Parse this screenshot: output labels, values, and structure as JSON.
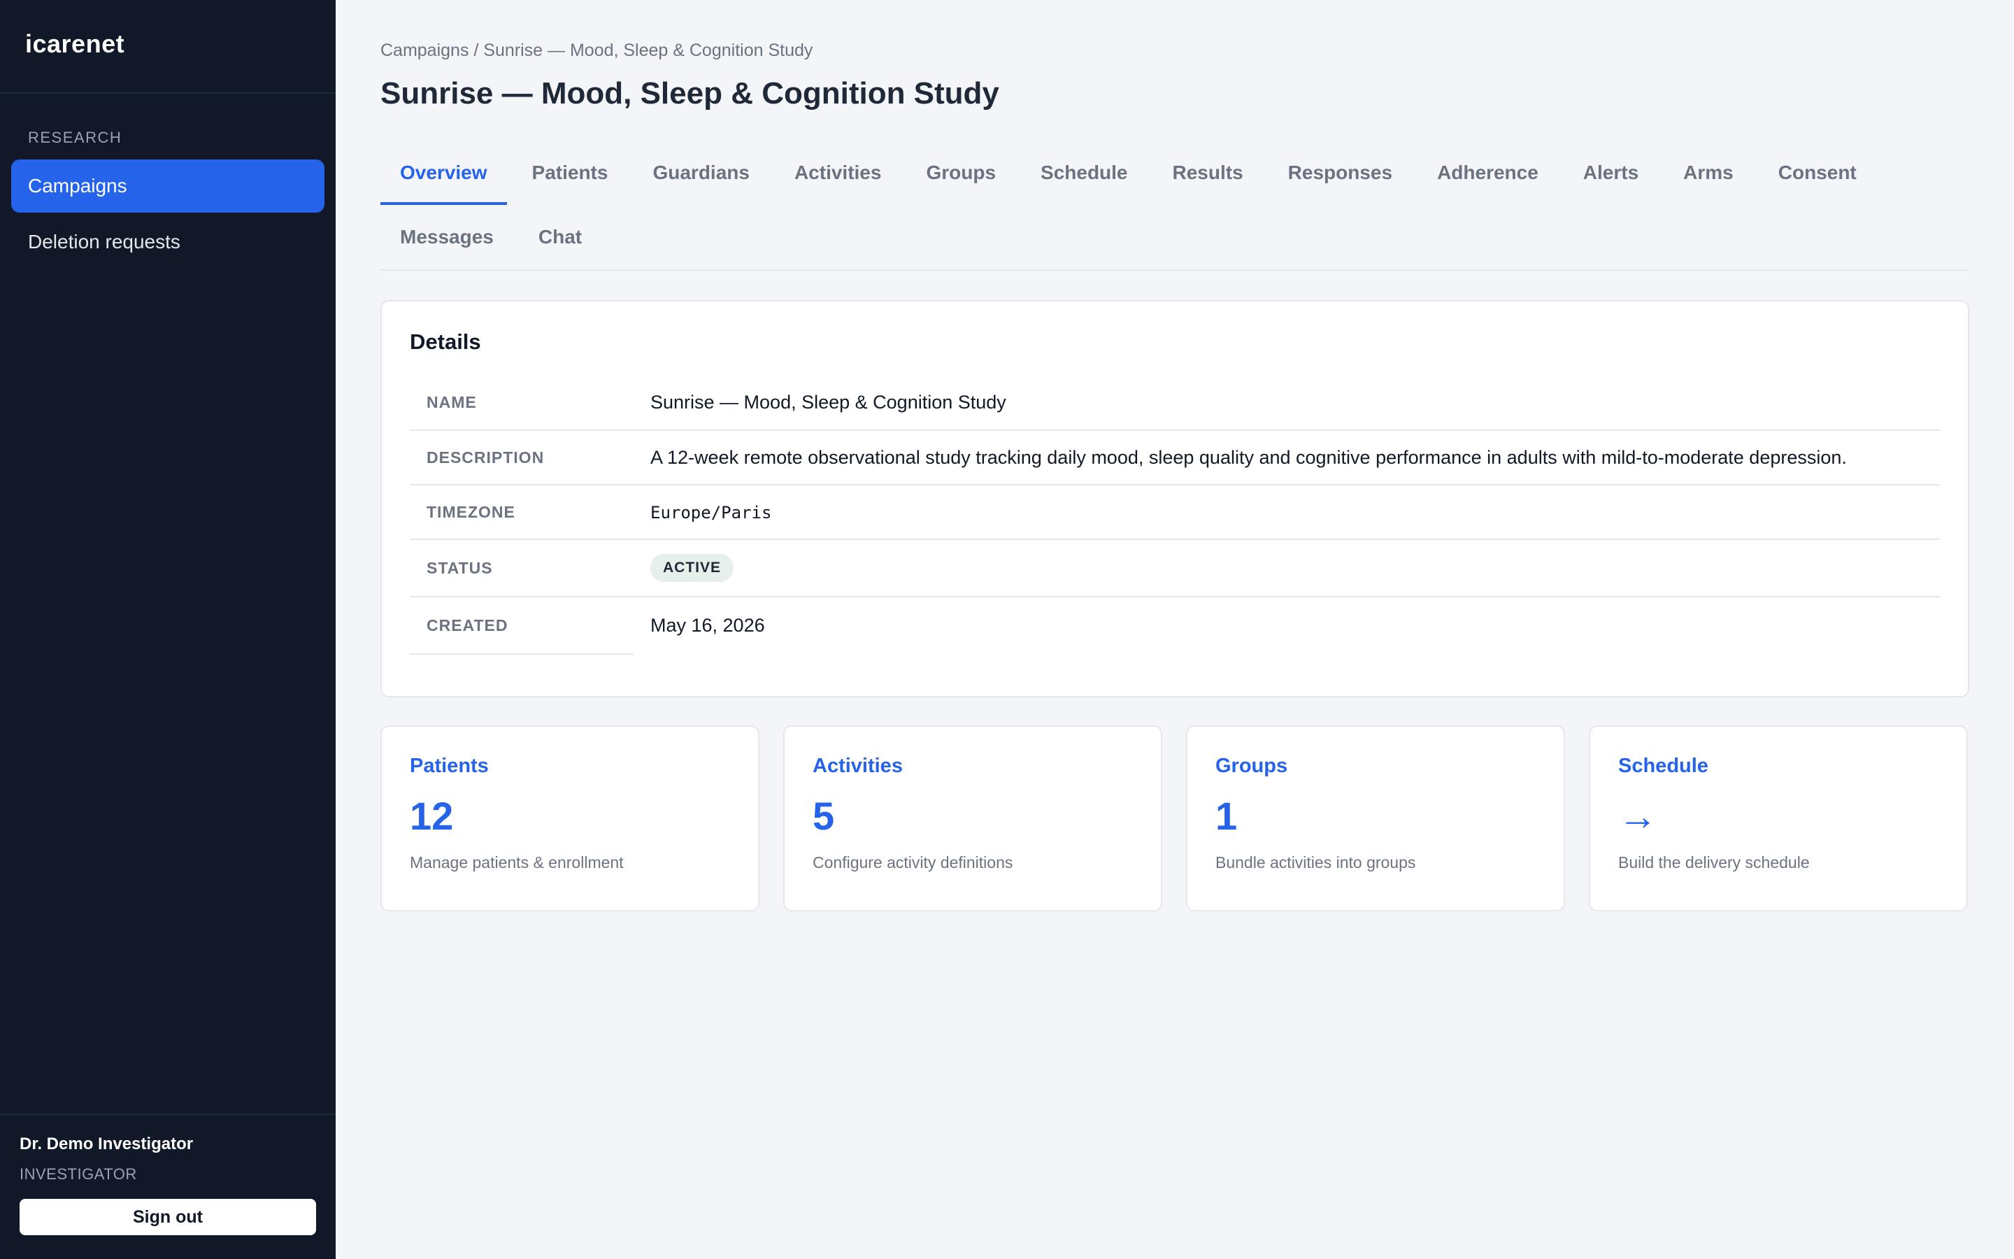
{
  "sidebar": {
    "brand": "icarenet",
    "section_label": "RESEARCH",
    "items": [
      {
        "label": "Campaigns",
        "active": true
      },
      {
        "label": "Deletion requests",
        "active": false
      }
    ],
    "user": {
      "name": "Dr. Demo Investigator",
      "role": "INVESTIGATOR",
      "signout_label": "Sign out"
    }
  },
  "header": {
    "breadcrumb": "Campaigns / Sunrise — Mood, Sleep & Cognition Study",
    "title": "Sunrise — Mood, Sleep & Cognition Study"
  },
  "tabs": [
    {
      "label": "Overview",
      "active": true
    },
    {
      "label": "Patients"
    },
    {
      "label": "Guardians"
    },
    {
      "label": "Activities"
    },
    {
      "label": "Groups"
    },
    {
      "label": "Schedule"
    },
    {
      "label": "Results"
    },
    {
      "label": "Responses"
    },
    {
      "label": "Adherence"
    },
    {
      "label": "Alerts"
    },
    {
      "label": "Arms"
    },
    {
      "label": "Consent"
    },
    {
      "label": "Messages"
    },
    {
      "label": "Chat"
    }
  ],
  "details": {
    "title": "Details",
    "rows": {
      "name": {
        "key": "NAME",
        "value": "Sunrise — Mood, Sleep & Cognition Study"
      },
      "description": {
        "key": "DESCRIPTION",
        "value": "A 12-week remote observational study tracking daily mood, sleep quality and cognitive performance in adults with mild-to-moderate depression."
      },
      "timezone": {
        "key": "TIMEZONE",
        "value": "Europe/Paris"
      },
      "status": {
        "key": "STATUS",
        "value": "ACTIVE"
      },
      "created": {
        "key": "CREATED",
        "value": "May 16, 2026"
      }
    }
  },
  "stats": [
    {
      "title": "Patients",
      "value": "12",
      "desc": "Manage patients & enrollment"
    },
    {
      "title": "Activities",
      "value": "5",
      "desc": "Configure activity definitions"
    },
    {
      "title": "Groups",
      "value": "1",
      "desc": "Bundle activities into groups"
    },
    {
      "title": "Schedule",
      "value": "→",
      "desc": "Build the delivery schedule"
    }
  ],
  "colors": {
    "sidebar_bg": "#111827",
    "accent": "#2563eb",
    "page_bg": "#f4f5f8",
    "badge_bg": "#e6efe9"
  }
}
